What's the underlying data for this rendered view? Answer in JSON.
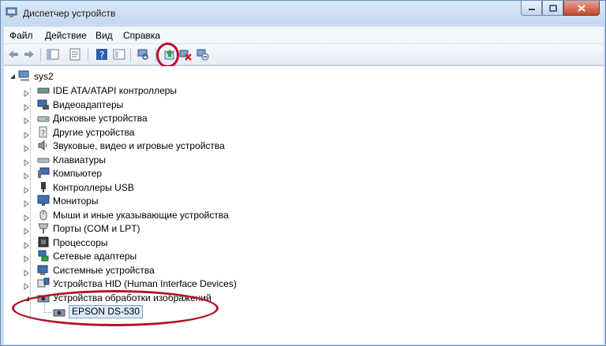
{
  "window": {
    "title": "Диспетчер устройств",
    "accent": "#b5122c"
  },
  "menu": {
    "file": "Файл",
    "action": "Действие",
    "view": "Вид",
    "help": "Справка"
  },
  "toolbar": {
    "icons": [
      "back-icon",
      "forward-icon",
      "show-hide-tree-icon",
      "properties-icon",
      "help-icon",
      "refresh-view-icon",
      "scan-hardware-icon",
      "update-driver-icon",
      "disable-device-icon",
      "uninstall-device-icon"
    ]
  },
  "tree": {
    "root": "sys2",
    "categories": [
      "IDE ATA/ATAPI контроллеры",
      "Видеоадаптеры",
      "Дисковые устройства",
      "Другие устройства",
      "Звуковые, видео и игровые устройства",
      "Клавиатуры",
      "Компьютер",
      "Контроллеры USB",
      "Мониторы",
      "Мыши и иные указывающие устройства",
      "Порты (COM и LPT)",
      "Процессоры",
      "Сетевые адаптеры",
      "Системные устройства",
      "Устройства HID (Human Interface Devices)",
      "Устройства обработки изображений"
    ],
    "child_device": "EPSON DS-530"
  }
}
